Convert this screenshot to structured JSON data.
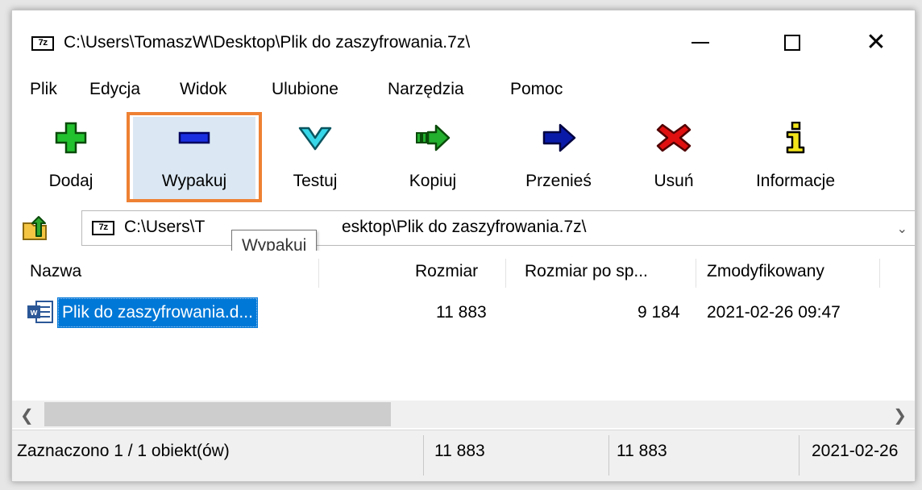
{
  "window": {
    "title": "C:\\Users\\TomaszW\\Desktop\\Plik do zaszyfrowania.7z\\",
    "app_icon_text": "7z"
  },
  "menu": [
    "Plik",
    "Edycja",
    "Widok",
    "Ulubione",
    "Narzędzia",
    "Pomoc"
  ],
  "toolbar": {
    "add": "Dodaj",
    "extract": "Wypakuj",
    "test": "Testuj",
    "copy": "Kopiuj",
    "move": "Przenieś",
    "delete": "Usuń",
    "info": "Informacje"
  },
  "address": {
    "path_visible_left": "C:\\Users\\T",
    "path_visible_right": "esktop\\Plik do zaszyfrowania.7z\\",
    "icon_text": "7z"
  },
  "tooltip": "Wypakuj",
  "columns": {
    "name": "Nazwa",
    "size": "Rozmiar",
    "packed": "Rozmiar po sp...",
    "modified": "Zmodyfikowany"
  },
  "rows": [
    {
      "name": "Plik do zaszyfrowania.d...",
      "size": "11 883",
      "packed": "9 184",
      "modified": "2021-02-26 09:47"
    }
  ],
  "status": {
    "selection": "Zaznaczono 1 / 1 obiekt(ów)",
    "size": "11 883",
    "packed": "11 883",
    "date": "2021-02-26"
  },
  "colors": {
    "highlight": "#ee8133",
    "selection": "#0078d7"
  }
}
